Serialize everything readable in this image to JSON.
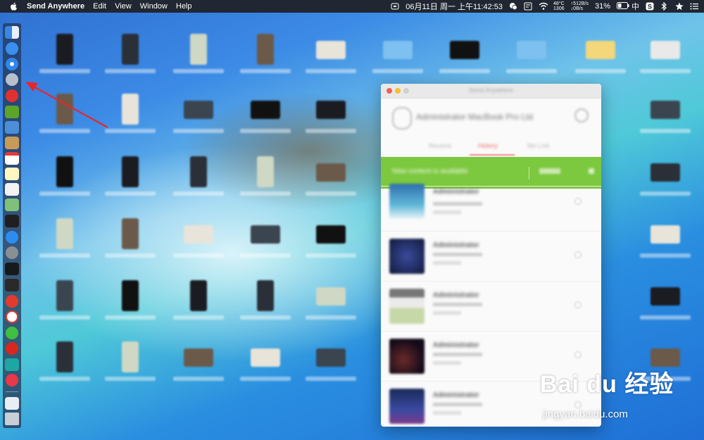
{
  "menubar": {
    "app_name": "Send Anywhere",
    "items": [
      "Edit",
      "View",
      "Window",
      "Help"
    ],
    "datetime": "06月11日 周一 上午11:42:53",
    "temperature": "48°C",
    "fan": "1306",
    "net_up": "↑512B/s",
    "net_down": "↓0B/s",
    "battery": "31%",
    "input_method": "中"
  },
  "window": {
    "title": "Send Anywhere",
    "device_name": "Administrator MacBook Pro Ltd",
    "tabs": [
      "Receive",
      "History",
      "Me Link"
    ],
    "banner_text": "New content is available",
    "items": [
      {
        "name": "Administrator"
      },
      {
        "name": "Administrator"
      },
      {
        "name": "Administrator"
      },
      {
        "name": "Administrator"
      },
      {
        "name": "Administrator"
      }
    ]
  },
  "watermark": {
    "main": "Bai du 经验",
    "sub": "jingyan.baidu.com"
  },
  "colors": {
    "menubar": "#202732",
    "banner_green": "#7cc83e",
    "arrow_red": "#e8262a"
  }
}
